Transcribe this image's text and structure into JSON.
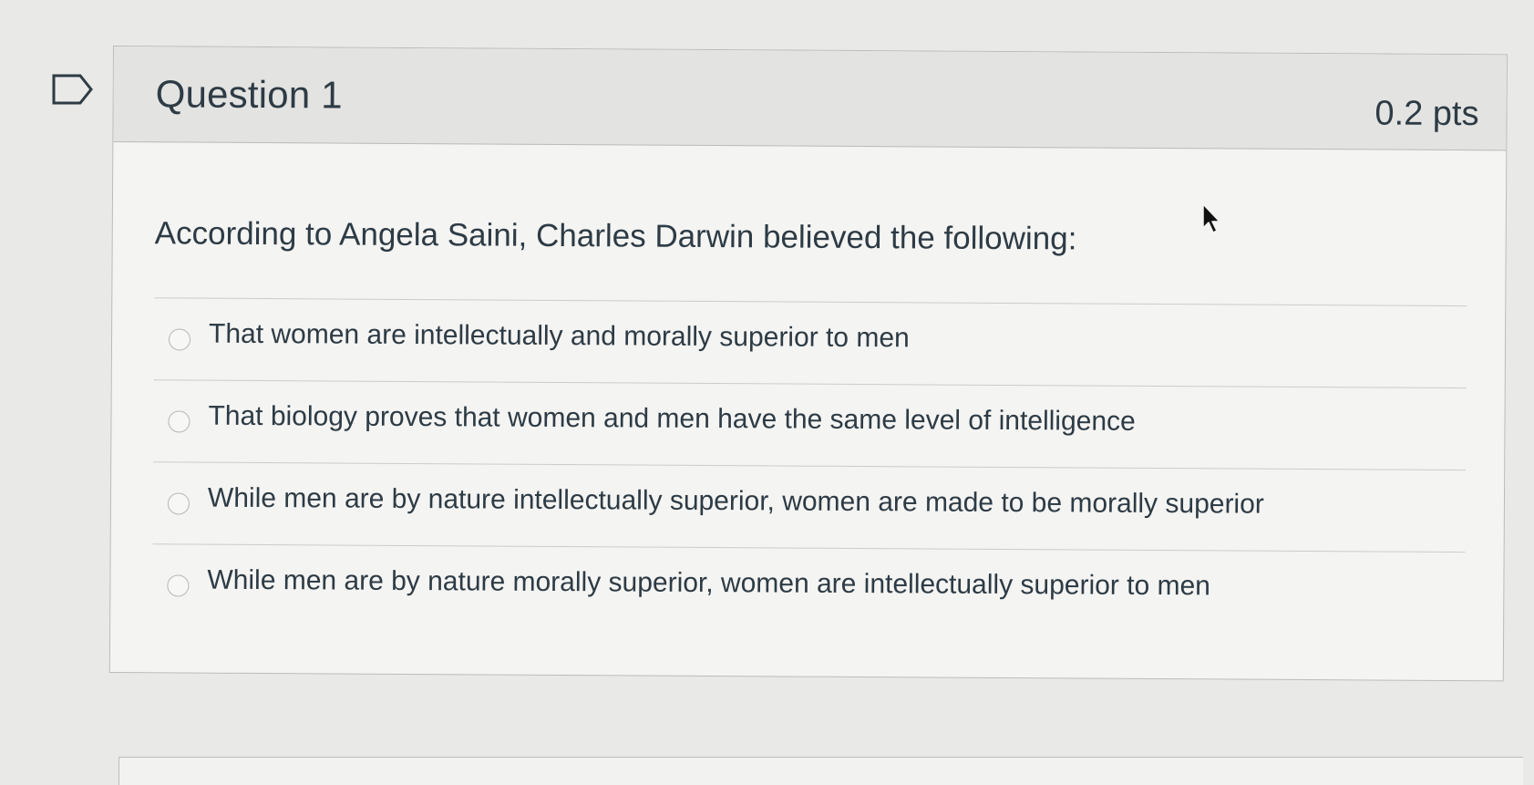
{
  "question": {
    "title": "Question 1",
    "points": "0.2 pts",
    "text": "According to Angela Saini, Charles Darwin believed the following:",
    "answers": [
      {
        "label": "That women are intellectually and morally superior to men",
        "selected": false
      },
      {
        "label": "That biology proves that women and men have the same level of intelligence",
        "selected": false
      },
      {
        "label": "While men are by nature intellectually superior, women are made to be morally superior",
        "selected": false
      },
      {
        "label": "While men are by nature morally superior, women are intellectually superior to men",
        "selected": false
      }
    ]
  },
  "icons": {
    "flag": "flag-icon",
    "cursor": "mouse-cursor-icon"
  },
  "colors": {
    "background": "#e9e9e7",
    "card": "#f4f4f2",
    "header": "#e3e3e1",
    "text": "#2d3b45",
    "border": "#b9bbbd"
  }
}
